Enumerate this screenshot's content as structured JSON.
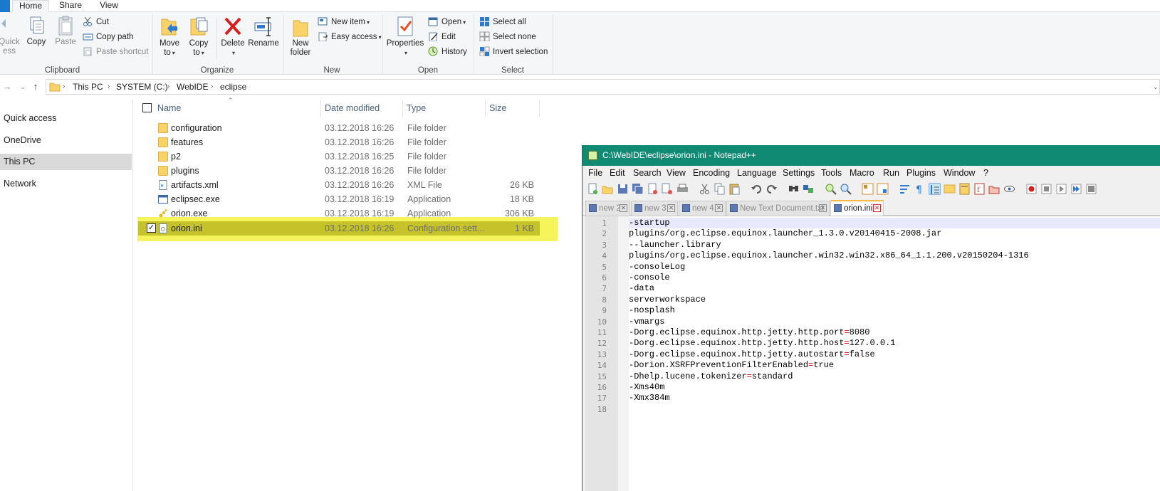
{
  "ribbon": {
    "tabs": [
      "Home",
      "Share",
      "View"
    ],
    "groups": {
      "clipboard": "Clipboard",
      "organize": "Organize",
      "new": "New",
      "open": "Open",
      "select": "Select"
    },
    "buttons": {
      "quick_access_1": "Quick",
      "quick_access_2": "ess",
      "copy": "Copy",
      "paste": "Paste",
      "cut": "Cut",
      "copy_path": "Copy path",
      "paste_shortcut": "Paste shortcut",
      "move_to_1": "Move",
      "move_to_2": "to",
      "copy_to_1": "Copy",
      "copy_to_2": "to",
      "delete": "Delete",
      "rename": "Rename",
      "new_folder_1": "New",
      "new_folder_2": "folder",
      "new_item": "New item",
      "easy_access": "Easy access",
      "properties": "Properties",
      "open": "Open",
      "edit": "Edit",
      "history": "History",
      "select_all": "Select all",
      "select_none": "Select none",
      "invert_selection": "Invert selection"
    }
  },
  "breadcrumb": [
    "This PC",
    "SYSTEM (C:)",
    "WebIDE",
    "eclipse"
  ],
  "nav": [
    "Quick access",
    "OneDrive",
    "This PC",
    "Network"
  ],
  "columns": {
    "name": "Name",
    "date": "Date modified",
    "type": "Type",
    "size": "Size"
  },
  "files": [
    {
      "name": "configuration",
      "date": "03.12.2018 16:26",
      "type": "File folder",
      "size": ""
    },
    {
      "name": "features",
      "date": "03.12.2018 16:26",
      "type": "File folder",
      "size": ""
    },
    {
      "name": "p2",
      "date": "03.12.2018 16:25",
      "type": "File folder",
      "size": ""
    },
    {
      "name": "plugins",
      "date": "03.12.2018 16:26",
      "type": "File folder",
      "size": ""
    },
    {
      "name": "artifacts.xml",
      "date": "03.12.2018 16:26",
      "type": "XML File",
      "size": "26 KB"
    },
    {
      "name": "eclipsec.exe",
      "date": "03.12.2018 16:19",
      "type": "Application",
      "size": "18 KB"
    },
    {
      "name": "orion.exe",
      "date": "03.12.2018 16:19",
      "type": "Application",
      "size": "306 KB"
    },
    {
      "name": "orion.ini",
      "date": "03.12.2018 16:26",
      "type": "Configuration sett...",
      "size": "1 KB"
    }
  ],
  "notepad": {
    "title": "C:\\WebIDE\\eclipse\\orion.ini - Notepad++",
    "menu": [
      "File",
      "Edit",
      "Search",
      "View",
      "Encoding",
      "Language",
      "Settings",
      "Tools",
      "Macro",
      "Run",
      "Plugins",
      "Window",
      "?"
    ],
    "tabs": [
      "new 2",
      "new 3",
      "new 4",
      "New Text Document.txt",
      "orion.ini"
    ],
    "lines": [
      {
        "n": "1",
        "pre": "-startup",
        "eq": "",
        "post": ""
      },
      {
        "n": "2",
        "pre": "plugins/org.eclipse.equinox.launcher_1.3.0.v20140415-2008.jar",
        "eq": "",
        "post": ""
      },
      {
        "n": "3",
        "pre": "--launcher.library",
        "eq": "",
        "post": ""
      },
      {
        "n": "4",
        "pre": "plugins/org.eclipse.equinox.launcher.win32.win32.x86_64_1.1.200.v20150204-1316",
        "eq": "",
        "post": ""
      },
      {
        "n": "5",
        "pre": "-consoleLog",
        "eq": "",
        "post": ""
      },
      {
        "n": "6",
        "pre": "-console",
        "eq": "",
        "post": ""
      },
      {
        "n": "7",
        "pre": "-data",
        "eq": "",
        "post": ""
      },
      {
        "n": "8",
        "pre": "serverworkspace",
        "eq": "",
        "post": ""
      },
      {
        "n": "9",
        "pre": "-nosplash",
        "eq": "",
        "post": ""
      },
      {
        "n": "10",
        "pre": "-vmargs",
        "eq": "",
        "post": ""
      },
      {
        "n": "11",
        "pre": "-Dorg.eclipse.equinox.http.jetty.http.port",
        "eq": "=",
        "post": "8080"
      },
      {
        "n": "12",
        "pre": "-Dorg.eclipse.equinox.http.jetty.http.host",
        "eq": "=",
        "post": "127.0.0.1"
      },
      {
        "n": "13",
        "pre": "-Dorg.eclipse.equinox.http.jetty.autostart",
        "eq": "=",
        "post": "false"
      },
      {
        "n": "14",
        "pre": "-Dorion.XSRFPreventionFilterEnabled",
        "eq": "=",
        "post": "true"
      },
      {
        "n": "15",
        "pre": "-Dhelp.lucene.tokenizer",
        "eq": "=",
        "post": "standard"
      },
      {
        "n": "16",
        "pre": "-Xms40m",
        "eq": "",
        "post": ""
      },
      {
        "n": "17",
        "pre": "-Xmx384m",
        "eq": "",
        "post": ""
      },
      {
        "n": "18",
        "pre": "",
        "eq": "",
        "post": ""
      }
    ]
  },
  "colors": {
    "npp_title": "#108a73",
    "highlight": "#f3f23d",
    "explorer_accent": "#1979ca",
    "equals_sign": "#e00000"
  }
}
